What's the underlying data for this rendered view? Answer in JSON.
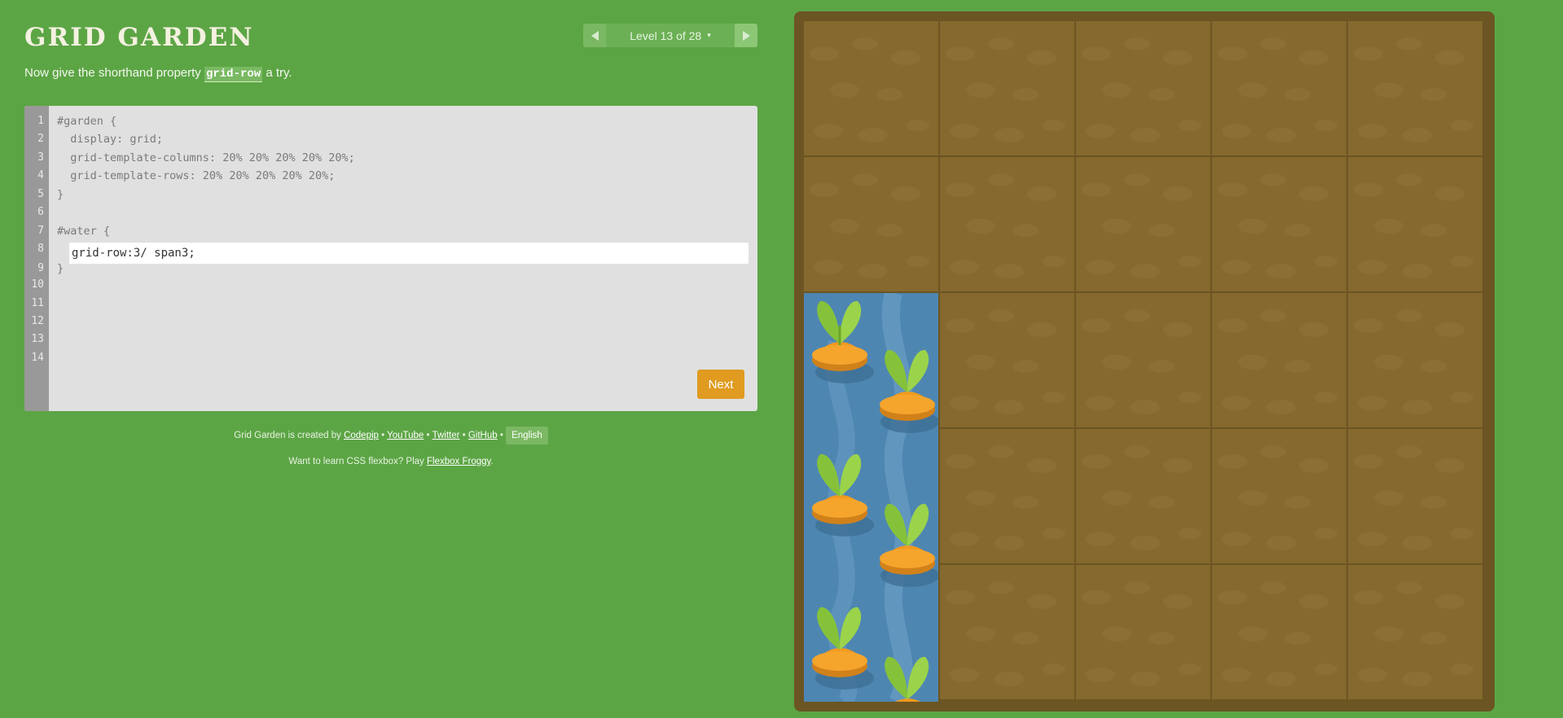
{
  "app": {
    "title": "GRID GARDEN"
  },
  "level_nav": {
    "label": "Level 13 of 28",
    "caret": "▾"
  },
  "instructions": {
    "before": "Now give the shorthand property ",
    "code": "grid-row",
    "after": " a try."
  },
  "editor": {
    "line_numbers": [
      "1",
      "2",
      "3",
      "4",
      "5",
      "6",
      "7",
      "8",
      "9",
      "10",
      "11",
      "12",
      "13",
      "14"
    ],
    "code_lines": [
      "#garden {",
      "  display: grid;",
      "  grid-template-columns: 20% 20% 20% 20% 20%;",
      "  grid-template-rows: 20% 20% 20% 20% 20%;",
      "}",
      "",
      "#water {",
      "",
      "}"
    ],
    "input_value": "grid-row:3/ span3;",
    "next_label": "Next"
  },
  "credits": {
    "prefix": "Grid Garden is created by ",
    "codepip": "Codepip",
    "youtube": "YouTube",
    "twitter": "Twitter",
    "github": "GitHub",
    "separator": " • ",
    "language": "English"
  },
  "promo": {
    "prefix": "Want to learn CSS flexbox? Play ",
    "link": "Flexbox Froggy",
    "suffix": "."
  },
  "garden": {
    "rows": 5,
    "columns": 5,
    "water": {
      "column": 1,
      "row_start": 3,
      "row_span": 3
    },
    "colors": {
      "soil": "#85692e",
      "frame": "#6b5523",
      "water": "#4e86b2",
      "carrot": "#f29a1f",
      "leaf": "#85c23a"
    }
  }
}
